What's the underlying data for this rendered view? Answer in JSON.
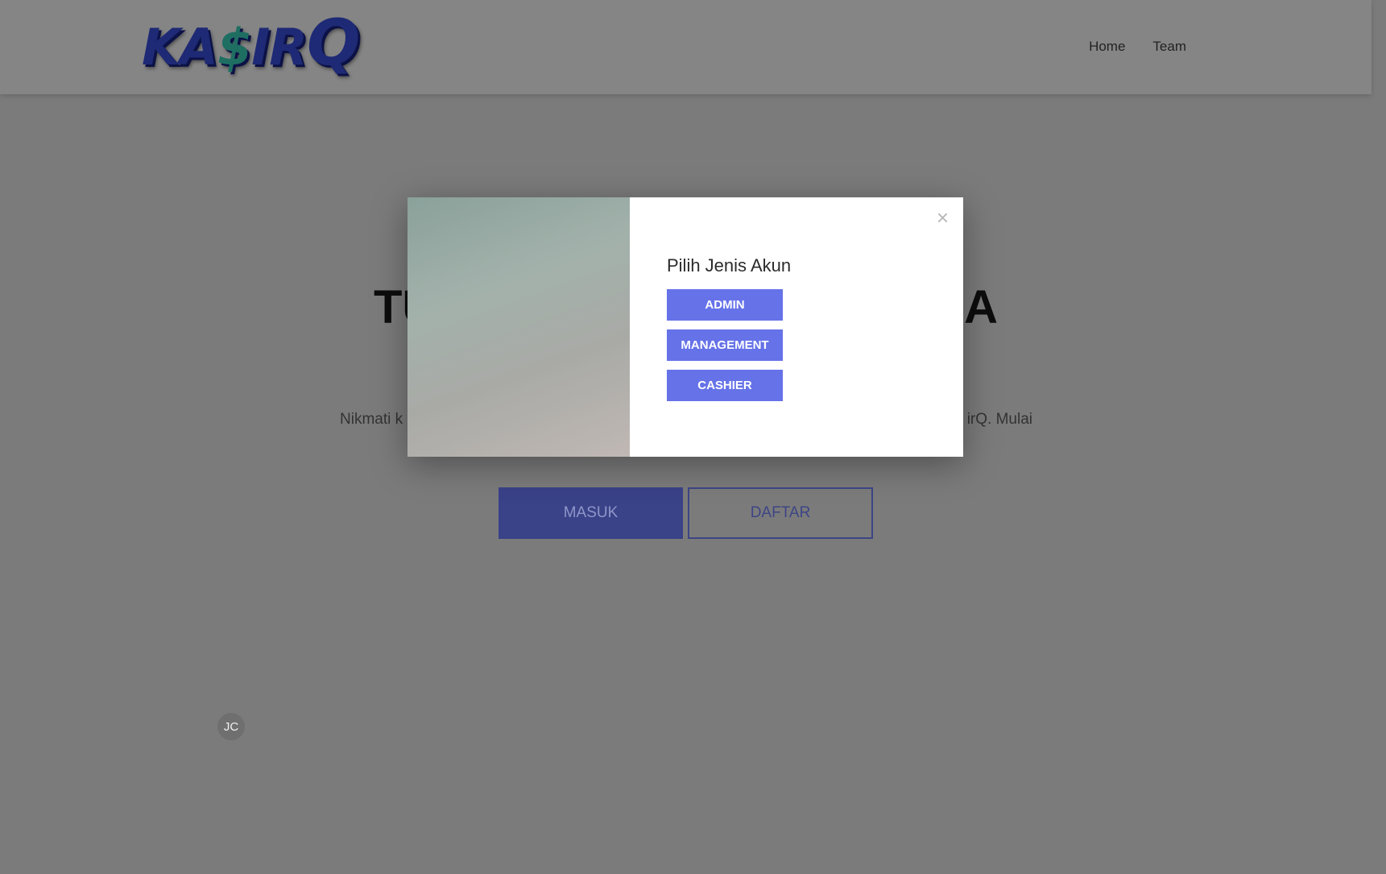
{
  "header": {
    "logo": {
      "part1": "KA",
      "dollar": "$",
      "part2": "IR",
      "q": "Q"
    },
    "nav": {
      "home": "Home",
      "team": "Team"
    }
  },
  "hero": {
    "title_left": "TU",
    "title_right": "A",
    "text_left": "Nikmati k",
    "text_right": "irQ. Mulai",
    "masuk_label": "MASUK",
    "daftar_label": "DAFTAR"
  },
  "avatar": {
    "initials": "JC"
  },
  "modal": {
    "close_symbol": "×",
    "title": "Pilih Jenis Akun",
    "roles": [
      "ADMIN",
      "MANAGEMENT",
      "CASHIER"
    ]
  },
  "colors": {
    "overlay_background": "#7b7b7b",
    "header_background": "#858585",
    "role_button": "#6672e8",
    "masuk_button": "#3a4288",
    "logo_blue": "#1e2a75",
    "logo_green": "#1f6e62"
  },
  "icons": {
    "close": "close-icon"
  }
}
